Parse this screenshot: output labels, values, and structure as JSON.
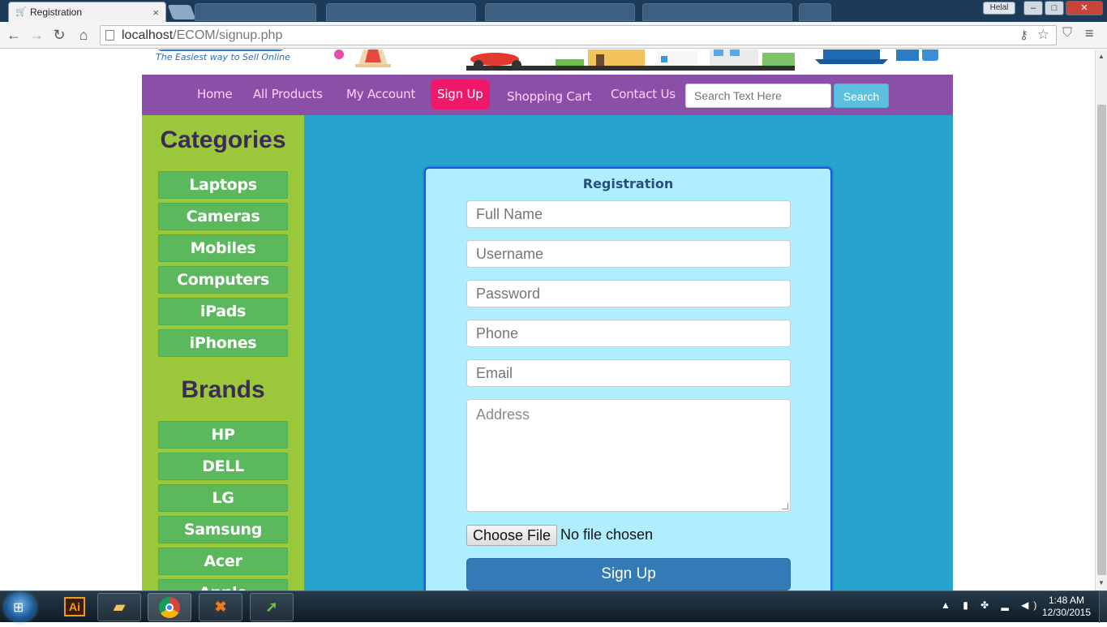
{
  "browser": {
    "tab_title": "Registration",
    "tab_close": "×",
    "url_host": "localhost",
    "url_path": "/ECOM/signup.php",
    "user_badge": "Helal",
    "window_minimize": "–",
    "window_maximize": "□",
    "window_close": "✕"
  },
  "site": {
    "tagline": "The Easiest way to Sell Online"
  },
  "nav": {
    "items": [
      {
        "label": "Home"
      },
      {
        "label": "All Products"
      },
      {
        "label": "My Account"
      },
      {
        "label": "Sign Up"
      },
      {
        "label": "Shopping Cart"
      },
      {
        "label": "Contact Us"
      }
    ],
    "search_placeholder": "Search Text Here",
    "search_button": "Search"
  },
  "sidebar": {
    "categories_heading": "Categories",
    "categories": [
      "Laptops",
      "Cameras",
      "Mobiles",
      "Computers",
      "iPads",
      "iPhones"
    ],
    "brands_heading": "Brands",
    "brands": [
      "HP",
      "DELL",
      "LG",
      "Samsung",
      "Acer",
      "Apple"
    ]
  },
  "registration": {
    "title": "Registration",
    "placeholders": {
      "full_name": "Full Name",
      "username": "Username",
      "password": "Password",
      "phone": "Phone",
      "email": "Email",
      "address": "Address"
    },
    "file_button": "Choose File",
    "file_status": "No file chosen",
    "submit": "Sign Up"
  },
  "taskbar": {
    "time": "1:48 AM",
    "date": "12/30/2015"
  },
  "colors": {
    "nav_bg": "#8a50a8",
    "nav_active": "#f0186a",
    "sidebar_bg": "#9bc83b",
    "sidebar_button": "#5cb85c",
    "main_bg": "#27a4ce",
    "form_bg": "#aeeeff",
    "submit_bg": "#337ab7"
  }
}
